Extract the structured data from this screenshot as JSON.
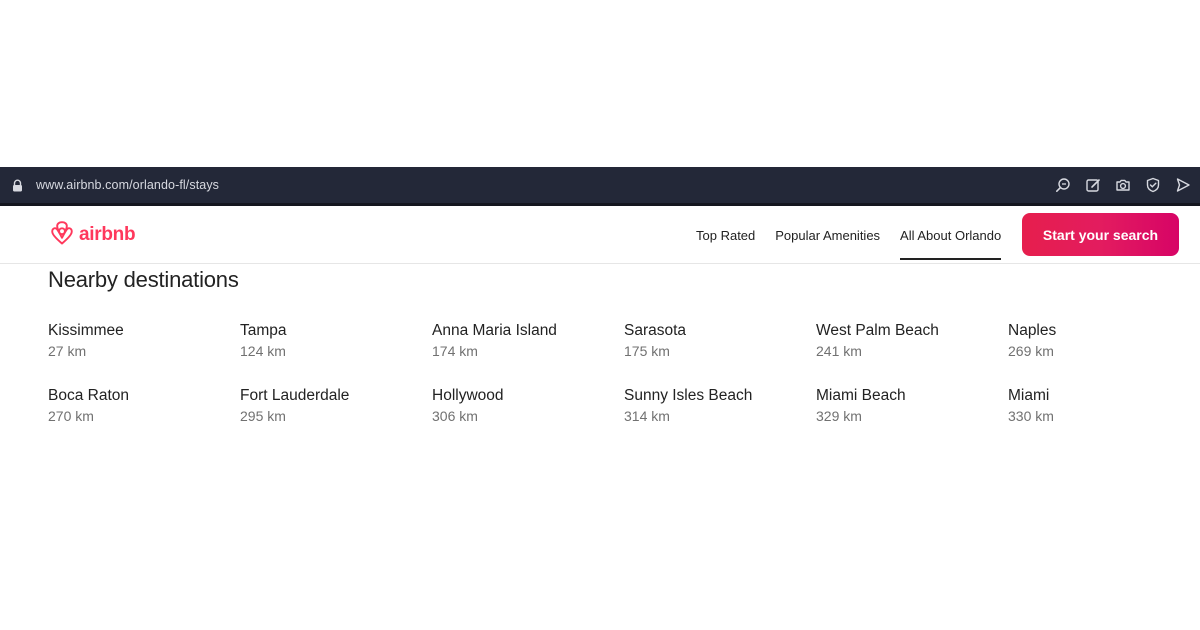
{
  "browser": {
    "url": "www.airbnb.com/orlando-fl/stays",
    "icons": [
      "lock-icon",
      "zoom-icon",
      "edit-icon",
      "camera-icon",
      "shield-icon",
      "send-icon"
    ]
  },
  "header": {
    "logo_text": "airbnb",
    "nav": [
      {
        "label": "Top Rated",
        "active": false
      },
      {
        "label": "Popular Amenities",
        "active": false
      },
      {
        "label": "All About Orlando",
        "active": true
      }
    ],
    "cta_label": "Start your search"
  },
  "colors": {
    "brand": "#FF385C",
    "cta_gradient_start": "#E61E4D",
    "cta_gradient_end": "#D70466",
    "browser_bar": "#232838",
    "muted_text": "#717171"
  },
  "main": {
    "section_title": "Nearby destinations",
    "destinations": [
      {
        "name": "Kissimmee",
        "distance": "27 km"
      },
      {
        "name": "Tampa",
        "distance": "124 km"
      },
      {
        "name": "Anna Maria Island",
        "distance": "174 km"
      },
      {
        "name": "Sarasota",
        "distance": "175 km"
      },
      {
        "name": "West Palm Beach",
        "distance": "241 km"
      },
      {
        "name": "Naples",
        "distance": "269 km"
      },
      {
        "name": "Boca Raton",
        "distance": "270 km"
      },
      {
        "name": "Fort Lauderdale",
        "distance": "295 km"
      },
      {
        "name": "Hollywood",
        "distance": "306 km"
      },
      {
        "name": "Sunny Isles Beach",
        "distance": "314 km"
      },
      {
        "name": "Miami Beach",
        "distance": "329 km"
      },
      {
        "name": "Miami",
        "distance": "330 km"
      }
    ]
  }
}
